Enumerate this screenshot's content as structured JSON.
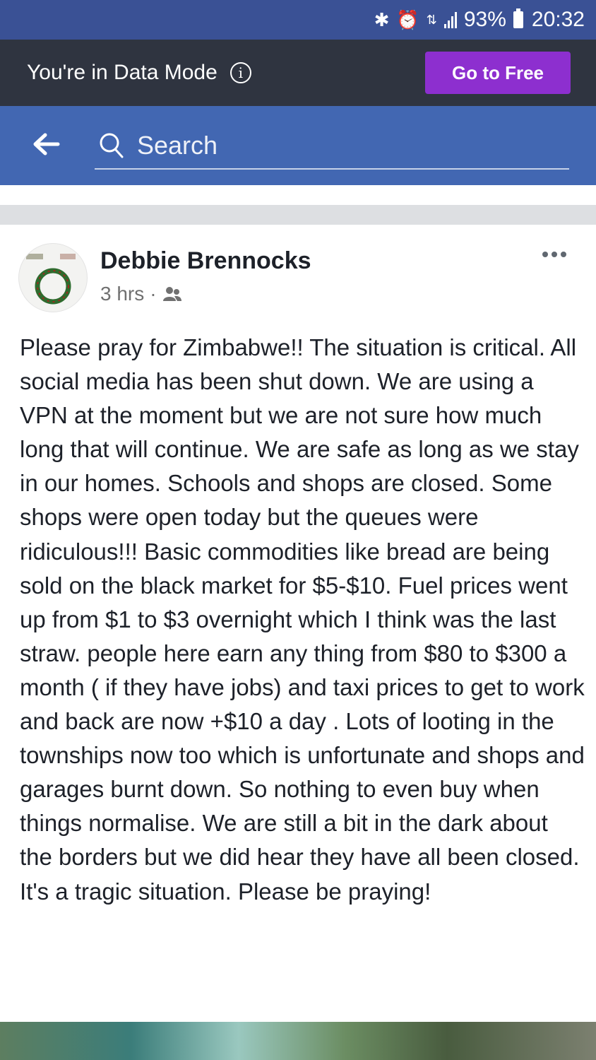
{
  "status_bar": {
    "battery": "93%",
    "time": "20:32",
    "icons": [
      "bluetooth-icon",
      "alarm-icon",
      "data-icon",
      "signal-icon",
      "battery-icon"
    ]
  },
  "data_mode": {
    "message": "You're in Data Mode",
    "button_label": "Go to Free",
    "button_color": "#8d2fcf"
  },
  "header": {
    "search_placeholder": "Search",
    "color": "#4267b2"
  },
  "post": {
    "author": "Debbie Brennocks",
    "time": "3 hrs",
    "separator": "·",
    "audience_icon": "friends-icon",
    "body": "Please pray for Zimbabwe!!  The situation is critical.  All social media has been shut down.  We are using a VPN at the moment but we are not sure how much long that will continue.  We are safe as long as we stay in our homes.  Schools and shops are closed.  Some shops were open today but the queues were ridiculous!!!  Basic commodities like bread are being sold on the black  market for $5-$10.  Fuel prices went up from $1 to $3 overnight which I think was the last straw. people here earn any thing from $80 to $300 a month ( if they have jobs) and taxi prices to get to work and back are now +$10 a day . Lots of looting in the townships now too which is unfortunate and shops and garages burnt down. So nothing to even buy when things normalise. We are still a bit in the dark about the borders but we did hear they have all been closed.  It's a tragic situation.  Please be praying!"
  }
}
